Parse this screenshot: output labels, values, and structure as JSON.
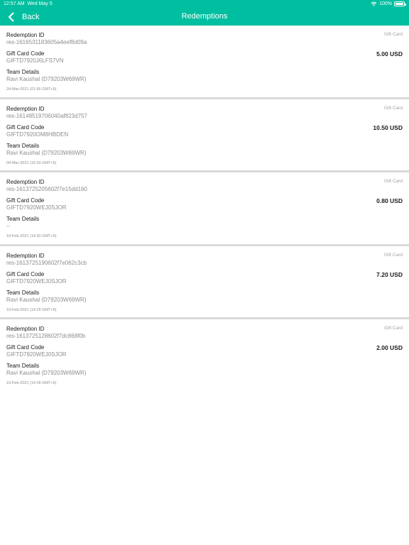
{
  "status_bar": {
    "time": "12:57 AM",
    "date": "Wed May 5",
    "battery": "100%",
    "wifi_icon": "wifi-icon",
    "battery_icon": "battery-icon"
  },
  "navbar": {
    "back_label": "Back",
    "back_icon": "chevron-left-icon",
    "title": "Redemptions",
    "color": "#00bfa0"
  },
  "field_labels": {
    "redemption_id": "Redemption ID",
    "gift_card_code": "Gift Card Code",
    "team_details": "Team Details"
  },
  "redemptions": [
    {
      "type": "Gift Card",
      "redemption_id": "res-1616531183605a4eef8d09a",
      "gift_card_code": "GIFTD7920J6LFS7VN",
      "amount": "5.00 USD",
      "team_details": "Ravi Kaushal (D79203W69WR)",
      "date": "24-Mar-2021 (01:56 GMT+5)"
    },
    {
      "type": "Gift Card",
      "redemption_id": "res-16148519706040af823d757",
      "gift_card_code": "GIFTD7920OM8HBDEN",
      "amount": "10.50 USD",
      "team_details": "Ravi Kaushal (D79203W69WR)",
      "date": "04-Mar-2021 (15:29 GMT+5)"
    },
    {
      "type": "Gift Card",
      "redemption_id": "res-1613725205602f7e15dd160",
      "gift_card_code": "GIFTD7920WEJ0SJOR",
      "amount": "0.80 USD",
      "team_details": "--",
      "date": "19-Feb-2021 (14:30 GMT+5)"
    },
    {
      "type": "Gift Card",
      "redemption_id": "res-1613725190602f7e062c3cb",
      "gift_card_code": "GIFTD7920WEJ0SJOR",
      "amount": "7.20 USD",
      "team_details": "Ravi Kaushal (D79203W69WR)",
      "date": "19-Feb-2021 (14:29 GMT+5)"
    },
    {
      "type": "Gift Card",
      "redemption_id": "res-1613725128602f7dc868f0b",
      "gift_card_code": "GIFTD7920WEJ0SJOR",
      "amount": "2.00 USD",
      "team_details": "Ravi Kaushal (D79203W69WR)",
      "date": "19-Feb-2021 (14:28 GMT+5)"
    }
  ]
}
